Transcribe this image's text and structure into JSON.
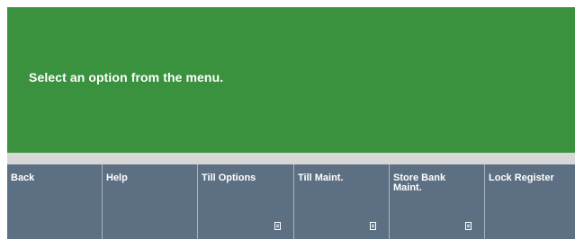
{
  "message": {
    "text": "Select an option from the menu."
  },
  "colors": {
    "message_background": "#3a923f",
    "button_background": "#5d7083",
    "text": "#ffffff"
  },
  "buttons": [
    {
      "label": "Back",
      "has_submenu": false
    },
    {
      "label": "Help",
      "has_submenu": false
    },
    {
      "label": "Till Options",
      "has_submenu": true,
      "icon": "submenu-icon"
    },
    {
      "label": "Till Maint.",
      "has_submenu": true,
      "icon": "submenu-icon"
    },
    {
      "label": "Store Bank Maint.",
      "has_submenu": true,
      "icon": "submenu-icon"
    },
    {
      "label": "Lock Register",
      "has_submenu": false
    }
  ]
}
